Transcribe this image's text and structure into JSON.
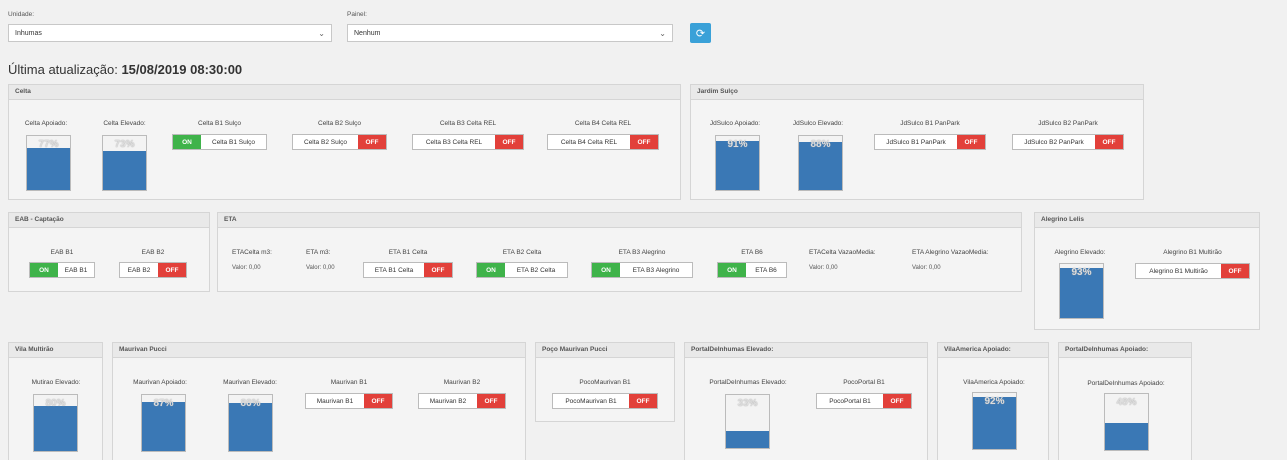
{
  "filters": {
    "unidade_label": "Unidade:",
    "unidade_value": "Inhumas",
    "painel_label": "Painel:",
    "painel_value": "Nenhum"
  },
  "updated": {
    "prefix": "Última atualização:",
    "value": "15/08/2019 08:30:00"
  },
  "toggle_on": "ON",
  "toggle_off": "OFF",
  "panels": {
    "celta": {
      "title": "Celta",
      "gauges": [
        {
          "label": "Celta Apoiado:",
          "percent": 77,
          "text": "77%"
        },
        {
          "label": "Celta Elevado:",
          "percent": 73,
          "text": "73%"
        }
      ],
      "switches": [
        {
          "label": "Celta B1 Sulço",
          "name": "Celta B1 Sulço",
          "state": "on"
        },
        {
          "label": "Celta B2 Sulço",
          "name": "Celta B2 Sulço",
          "state": "off"
        },
        {
          "label": "Celta B3 Celta REL",
          "name": "Celta B3 Celta REL",
          "state": "off"
        },
        {
          "label": "Celta B4 Celta REL",
          "name": "Celta B4 Celta REL",
          "state": "off"
        }
      ]
    },
    "jardim": {
      "title": "Jardim Sulço",
      "gauges": [
        {
          "label": "JdSulco Apoiado:",
          "percent": 91,
          "text": "91%"
        },
        {
          "label": "JdSulco Elevado:",
          "percent": 88,
          "text": "88%"
        }
      ],
      "switches": [
        {
          "label": "JdSulco B1 PanPark",
          "name": "JdSulco B1 PanPark",
          "state": "off"
        },
        {
          "label": "JdSulco B2 PanPark",
          "name": "JdSulco B2 PanPark",
          "state": "off"
        }
      ]
    },
    "eab": {
      "title": "EAB - Captação",
      "switches": [
        {
          "label": "EAB B1",
          "name": "EAB B1",
          "state": "on"
        },
        {
          "label": "EAB B2",
          "name": "EAB B2",
          "state": "off"
        }
      ]
    },
    "eta": {
      "title": "ETA",
      "values": [
        {
          "label": "ETACelta m3:",
          "value": "Valor: 0,00"
        },
        {
          "label": "ETA m3:",
          "value": "Valor: 0,00"
        }
      ],
      "switches": [
        {
          "label": "ETA B1 Celta",
          "name": "ETA B1 Celta",
          "state": "off"
        },
        {
          "label": "ETA B2 Celta",
          "name": "ETA B2 Celta",
          "state": "on"
        },
        {
          "label": "ETA B3 Alegrino",
          "name": "ETA B3 Alegrino",
          "state": "on"
        },
        {
          "label": "ETA B6",
          "name": "ETA B6",
          "state": "on"
        }
      ],
      "values2": [
        {
          "label": "ETACelta VazaoMedia:",
          "value": "Valor: 0,00"
        },
        {
          "label": "ETA Alegrino VazaoMedia:",
          "value": "Valor: 0,00"
        }
      ]
    },
    "alegrino": {
      "title": "Alegrino Lelis",
      "gauges": [
        {
          "label": "Alegrino Elevado:",
          "percent": 93,
          "text": "93%"
        }
      ],
      "switches": [
        {
          "label": "Alegrino B1 Multirão",
          "name": "Alegrino B1 Multirão",
          "state": "off"
        }
      ]
    },
    "vila": {
      "title": "Vila Multirão",
      "gauges": [
        {
          "label": "Mutirao Elevado:",
          "percent": 80,
          "text": "80%"
        }
      ]
    },
    "maurivan": {
      "title": "Maurivan Pucci",
      "gauges": [
        {
          "label": "Maurivan Apoiado:",
          "percent": 87,
          "text": "87%"
        },
        {
          "label": "Maurivan Elevado:",
          "percent": 86,
          "text": "86%"
        }
      ],
      "switches": [
        {
          "label": "Maurivan B1",
          "name": "Maurivan B1",
          "state": "off"
        },
        {
          "label": "Maurivan B2",
          "name": "Maurivan B2",
          "state": "off"
        }
      ]
    },
    "poco": {
      "title": "Poço Maurivan Pucci",
      "switches": [
        {
          "label": "PocoMaurivan B1",
          "name": "PocoMaurivan B1",
          "state": "off"
        }
      ]
    },
    "portal_elev": {
      "title": "PortalDeInhumas Elevado:",
      "gauges": [
        {
          "label": "PortalDeInhumas Elevado:",
          "percent": 33,
          "text": "33%"
        }
      ],
      "switches": [
        {
          "label": "PocoPortal B1",
          "name": "PocoPortal B1",
          "state": "off"
        }
      ]
    },
    "vilaamerica": {
      "title": "VilaAmerica Apoiado:",
      "gauges": [
        {
          "label": "VilaAmerica Apoiado:",
          "percent": 92,
          "text": "92%"
        }
      ]
    },
    "portal_apo": {
      "title": "PortalDeInhumas Apoiado:",
      "gauges": [
        {
          "label": "PortalDeInhumas Apoiado:",
          "percent": 48,
          "text": "48%"
        }
      ]
    }
  },
  "colors": {
    "on": "#3fb34a",
    "off": "#e2403a",
    "gauge_fill": "#3a78b5",
    "refresh": "#3aa1d8"
  }
}
